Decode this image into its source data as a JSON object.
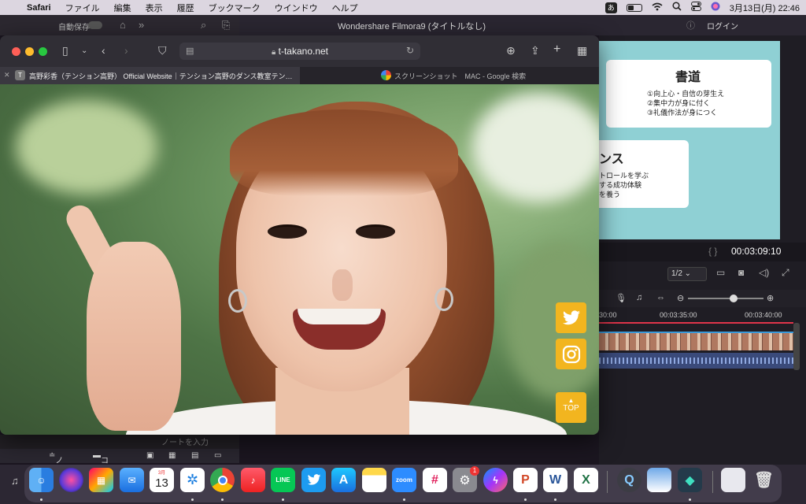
{
  "menubar": {
    "app_name": "Safari",
    "items": [
      "ファイル",
      "編集",
      "表示",
      "履歴",
      "ブックマーク",
      "ウインドウ",
      "ヘルプ"
    ],
    "ime": "あ",
    "datetime": "3月13日(月)  22:46"
  },
  "notes_app": {
    "autosave_label": "自動保存",
    "autosave_state": "オフ",
    "input_prompt": "ノートを入力",
    "tabs": [
      "ノート",
      "コメント"
    ]
  },
  "filmora": {
    "window_title": "Wondershare Filmora9 (タイトルなし)",
    "login_label": "ログイン",
    "preview": {
      "card1_title": "書道",
      "card1_lines": [
        "①向上心・自信の芽生え",
        "②集中力が身に付く",
        "③礼儀作法が身につく"
      ],
      "card2_title": "ンス",
      "card2_lines": [
        "トロールを学ぶ",
        "する成功体験",
        "を養う"
      ]
    },
    "timecode": "00:03:09:10",
    "ratio": "1/2",
    "ruler_labels": [
      "30:00",
      "00:03:35:00",
      "00:03:40:00"
    ]
  },
  "safari": {
    "url": "t-takano.net",
    "tabs": [
      {
        "favicon": "T",
        "title": "高野彩香（テンション高野） Official Website｜テンション高野のダンス教室テンタカダンススクール"
      },
      {
        "favicon": "google-icon",
        "title": "スクリーンショット　MAC - Google 検索"
      }
    ],
    "page": {
      "top_button": "TOP"
    }
  },
  "dock": {
    "calendar": {
      "month": "3月",
      "day": "13"
    },
    "zoom_label": "zoom",
    "settings_badge": "1",
    "apps": [
      "Finder",
      "Siri",
      "Launchpad",
      "Mail",
      "Calendar",
      "Safari",
      "Chrome",
      "Music",
      "LINE",
      "Twitter",
      "App Store",
      "Notes",
      "Zoom",
      "Slack",
      "System Preferences",
      "Messenger",
      "PowerPoint",
      "Word",
      "Excel",
      "QuickTime Player",
      "Preview",
      "Filmora",
      "Preview Document",
      "Trash"
    ]
  },
  "colors": {
    "accent_social": "#f2b51f",
    "traffic_red": "#fe5f57",
    "traffic_yellow": "#febc2e",
    "traffic_green": "#28c840",
    "playhead": "#e0344a"
  }
}
